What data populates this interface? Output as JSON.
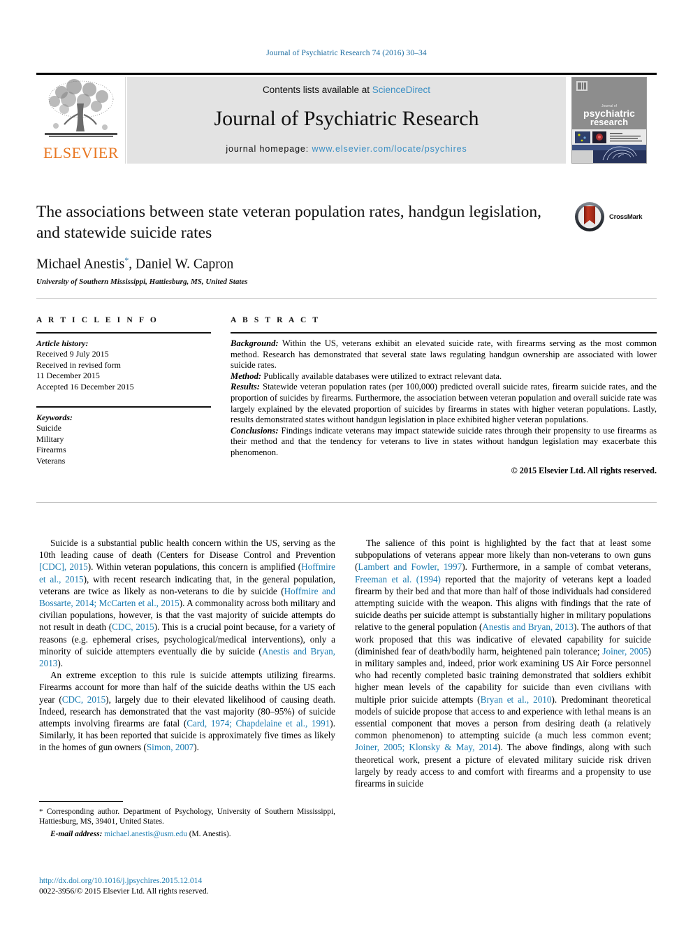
{
  "running_head": "Journal of Psychiatric Research 74 (2016) 30–34",
  "header": {
    "contents_prefix": "Contents lists available at ",
    "sciencedirect": "ScienceDirect",
    "journal_title": "Journal of Psychiatric Research",
    "homepage_prefix": "journal homepage: ",
    "homepage_url": "www.elsevier.com/locate/psychires",
    "publisher": "ELSEVIER",
    "cover_title_line1": "psychiatric",
    "cover_title_line2": "research",
    "colors": {
      "link": "#3b8fc4",
      "elsevier_orange": "#E87722",
      "panel_bg": "#e3e3e3",
      "running_head": "#1a6ba0",
      "citation_link": "#1a7bb0"
    }
  },
  "title_block": {
    "title": "The associations between state veteran population rates, handgun legislation, and statewide suicide rates",
    "authors": "Michael Anestis",
    "author_marker": "*",
    "authors_rest": ", Daniel W. Capron",
    "affiliation": "University of Southern Mississippi, Hattiesburg, MS, United States",
    "crossmark_label": "CrossMark"
  },
  "article_info": {
    "heading": "A R T I C L E   I N F O",
    "history_label": "Article history:",
    "history_lines": [
      "Received 9 July 2015",
      "Received in revised form",
      "11 December 2015",
      "Accepted 16 December 2015"
    ],
    "keywords_label": "Keywords:",
    "keywords": [
      "Suicide",
      "Military",
      "Firearms",
      "Veterans"
    ]
  },
  "abstract": {
    "heading": "A B S T R A C T",
    "background_label": "Background:",
    "background_text": " Within the US, veterans exhibit an elevated suicide rate, with firearms serving as the most common method. Research has demonstrated that several state laws regulating handgun ownership are associated with lower suicide rates.",
    "method_label": "Method:",
    "method_text": " Publically available databases were utilized to extract relevant data.",
    "results_label": "Results:",
    "results_text": " Statewide veteran population rates (per 100,000) predicted overall suicide rates, firearm suicide rates, and the proportion of suicides by firearms. Furthermore, the association between veteran population and overall suicide rate was largely explained by the elevated proportion of suicides by firearms in states with higher veteran populations. Lastly, results demonstrated states without handgun legislation in place exhibited higher veteran populations.",
    "conclusions_label": "Conclusions:",
    "conclusions_text": " Findings indicate veterans may impact statewide suicide rates through their propensity to use firearms as their method and that the tendency for veterans to live in states without handgun legislation may exacerbate this phenomenon.",
    "copyright": "© 2015 Elsevier Ltd. All rights reserved."
  },
  "body": {
    "left": [
      {
        "segments": [
          {
            "t": "Suicide is a substantial public health concern within the US, serving as the 10th leading cause of death (Centers for Disease Control and Prevention ",
            "ref": false
          },
          {
            "t": "[CDC], 2015",
            "ref": true
          },
          {
            "t": "). Within veteran populations, this concern is amplified (",
            "ref": false
          },
          {
            "t": "Hoffmire et al., 2015",
            "ref": true
          },
          {
            "t": "), with recent research indicating that, in the general population, veterans are twice as likely as non-veterans to die by suicide (",
            "ref": false
          },
          {
            "t": "Hoffmire and Bossarte, 2014; McCarten et al., 2015",
            "ref": true
          },
          {
            "t": "). A commonality across both military and civilian populations, however, is that the vast majority of suicide attempts do not result in death (",
            "ref": false
          },
          {
            "t": "CDC, 2015",
            "ref": true
          },
          {
            "t": "). This is a crucial point because, for a variety of reasons (e.g. ephemeral crises, psychological/medical interventions), only a minority of suicide attempters eventually die by suicide (",
            "ref": false
          },
          {
            "t": "Anestis and Bryan, 2013",
            "ref": true
          },
          {
            "t": ").",
            "ref": false
          }
        ]
      },
      {
        "segments": [
          {
            "t": "An extreme exception to this rule is suicide attempts utilizing firearms. Firearms account for more than half of the suicide deaths within the US each year (",
            "ref": false
          },
          {
            "t": "CDC, 2015",
            "ref": true
          },
          {
            "t": "), largely due to their elevated likelihood of causing death. Indeed, research has demonstrated that the vast majority (80–95%) of suicide attempts involving firearms are fatal (",
            "ref": false
          },
          {
            "t": "Card, 1974; Chapdelaine et al., 1991",
            "ref": true
          },
          {
            "t": "). Similarly, it has been reported that suicide is approximately five times as likely in the homes of gun owners (",
            "ref": false
          },
          {
            "t": "Simon, 2007",
            "ref": true
          },
          {
            "t": ").",
            "ref": false
          }
        ]
      }
    ],
    "right": [
      {
        "segments": [
          {
            "t": "The salience of this point is highlighted by the fact that at least some subpopulations of veterans appear more likely than non-veterans to own guns (",
            "ref": false
          },
          {
            "t": "Lambert and Fowler, 1997",
            "ref": true
          },
          {
            "t": "). Furthermore, in a sample of combat veterans, ",
            "ref": false
          },
          {
            "t": "Freeman et al. (1994)",
            "ref": true
          },
          {
            "t": " reported that the majority of veterans kept a loaded firearm by their bed and that more than half of those individuals had considered attempting suicide with the weapon. This aligns with findings that the rate of suicide deaths per suicide attempt is substantially higher in military populations relative to the general population (",
            "ref": false
          },
          {
            "t": "Anestis and Bryan, 2013",
            "ref": true
          },
          {
            "t": "). The authors of that work proposed that this was indicative of elevated capability for suicide (diminished fear of death/bodily harm, heightened pain tolerance; ",
            "ref": false
          },
          {
            "t": "Joiner, 2005",
            "ref": true
          },
          {
            "t": ") in military samples and, indeed, prior work examining US Air Force personnel who had recently completed basic training demonstrated that soldiers exhibit higher mean levels of the capability for suicide than even civilians with multiple prior suicide attempts (",
            "ref": false
          },
          {
            "t": "Bryan et al., 2010",
            "ref": true
          },
          {
            "t": "). Predominant theoretical models of suicide propose that access to and experience with lethal means is an essential component that moves a person from desiring death (a relatively common phenomenon) to attempting suicide (a much less common event; ",
            "ref": false
          },
          {
            "t": "Joiner, 2005; Klonsky & May, 2014",
            "ref": true
          },
          {
            "t": "). The above findings, along with such theoretical work, present a picture of elevated military suicide risk driven largely by ready access to and comfort with firearms and a propensity to use firearms in suicide",
            "ref": false
          }
        ]
      }
    ]
  },
  "footnote": {
    "marker": "*",
    "text": " Corresponding author. Department of Psychology, University of Southern Mississippi, Hattiesburg, MS, 39401, United States.",
    "email_label": "E-mail address:",
    "email": "michael.anestis@usm.edu",
    "email_suffix": " (M. Anestis)."
  },
  "doi_block": {
    "doi_url": "http://dx.doi.org/10.1016/j.jpsychires.2015.12.014",
    "issn_line": "0022-3956/© 2015 Elsevier Ltd. All rights reserved."
  }
}
